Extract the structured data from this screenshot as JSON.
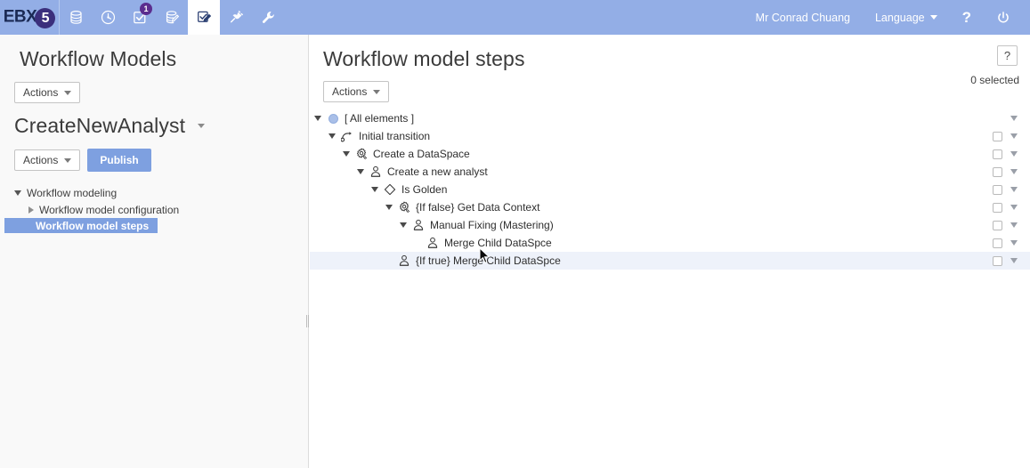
{
  "header": {
    "logo_text": "EBX",
    "logo_badge": "5",
    "nav_icons": [
      {
        "name": "datasets-icon",
        "badge": null,
        "active": false
      },
      {
        "name": "history-clock-icon",
        "badge": null,
        "active": false
      },
      {
        "name": "tasks-checkbox-icon",
        "badge": "1",
        "active": false
      },
      {
        "name": "data-models-icon",
        "badge": null,
        "active": false
      },
      {
        "name": "workflow-models-icon",
        "badge": null,
        "active": true
      },
      {
        "name": "addons-plug-icon",
        "badge": null,
        "active": false
      },
      {
        "name": "administration-wrench-icon",
        "badge": null,
        "active": false
      }
    ],
    "user_name": "Mr Conrad Chuang",
    "language_label": "Language",
    "help_label": "?",
    "logout_label": "power-icon"
  },
  "sidebar": {
    "title": "Workflow Models",
    "actions_label": "Actions",
    "model_name": "CreateNewAnalyst",
    "model_actions_label": "Actions",
    "publish_label": "Publish",
    "tree": [
      {
        "label": "Workflow modeling",
        "level": 1,
        "expanded": true,
        "selected": false
      },
      {
        "label": "Workflow model configuration",
        "level": 2,
        "expanded": false,
        "selected": false
      },
      {
        "label": "Workflow model steps",
        "level": 2,
        "expanded": null,
        "selected": true
      }
    ]
  },
  "main": {
    "title": "Workflow model steps",
    "actions_label": "Actions",
    "help_label": "?",
    "selected_count": "0 selected",
    "rows": [
      {
        "label": "[ All elements ]",
        "level": 0,
        "icon": "blue-circle-icon",
        "caret": true,
        "checkbox": false,
        "highlighted": false
      },
      {
        "label": "Initial transition",
        "level": 1,
        "icon": "transition-arrow-icon",
        "caret": true,
        "checkbox": true,
        "highlighted": false
      },
      {
        "label": "Create a DataSpace",
        "level": 2,
        "icon": "script-gear-icon",
        "caret": true,
        "checkbox": true,
        "highlighted": false
      },
      {
        "label": "Create a new analyst",
        "level": 3,
        "icon": "user-task-icon",
        "caret": true,
        "checkbox": true,
        "highlighted": false
      },
      {
        "label": "Is Golden",
        "level": 4,
        "icon": "condition-diamond-icon",
        "caret": true,
        "checkbox": true,
        "highlighted": false
      },
      {
        "label": "{If false} Get Data Context",
        "level": 5,
        "icon": "script-gear-icon",
        "caret": true,
        "checkbox": true,
        "highlighted": false
      },
      {
        "label": "Manual Fixing (Mastering)",
        "level": 6,
        "icon": "user-task-icon",
        "caret": true,
        "checkbox": true,
        "highlighted": false
      },
      {
        "label": "Merge Child DataSpce",
        "level": 7,
        "icon": "user-task-icon",
        "caret": false,
        "checkbox": true,
        "highlighted": false
      },
      {
        "label": "{If true} Merge Child DataSpce",
        "level": 5,
        "icon": "user-task-icon",
        "caret": false,
        "checkbox": true,
        "highlighted": true
      }
    ]
  },
  "colors": {
    "header_bg": "#93aee6",
    "accent_blue": "#7ea0e0",
    "highlight_row": "#eef2fa",
    "sidebar_bg": "#f9f9f9",
    "badge_purple": "#5b2d8e"
  }
}
